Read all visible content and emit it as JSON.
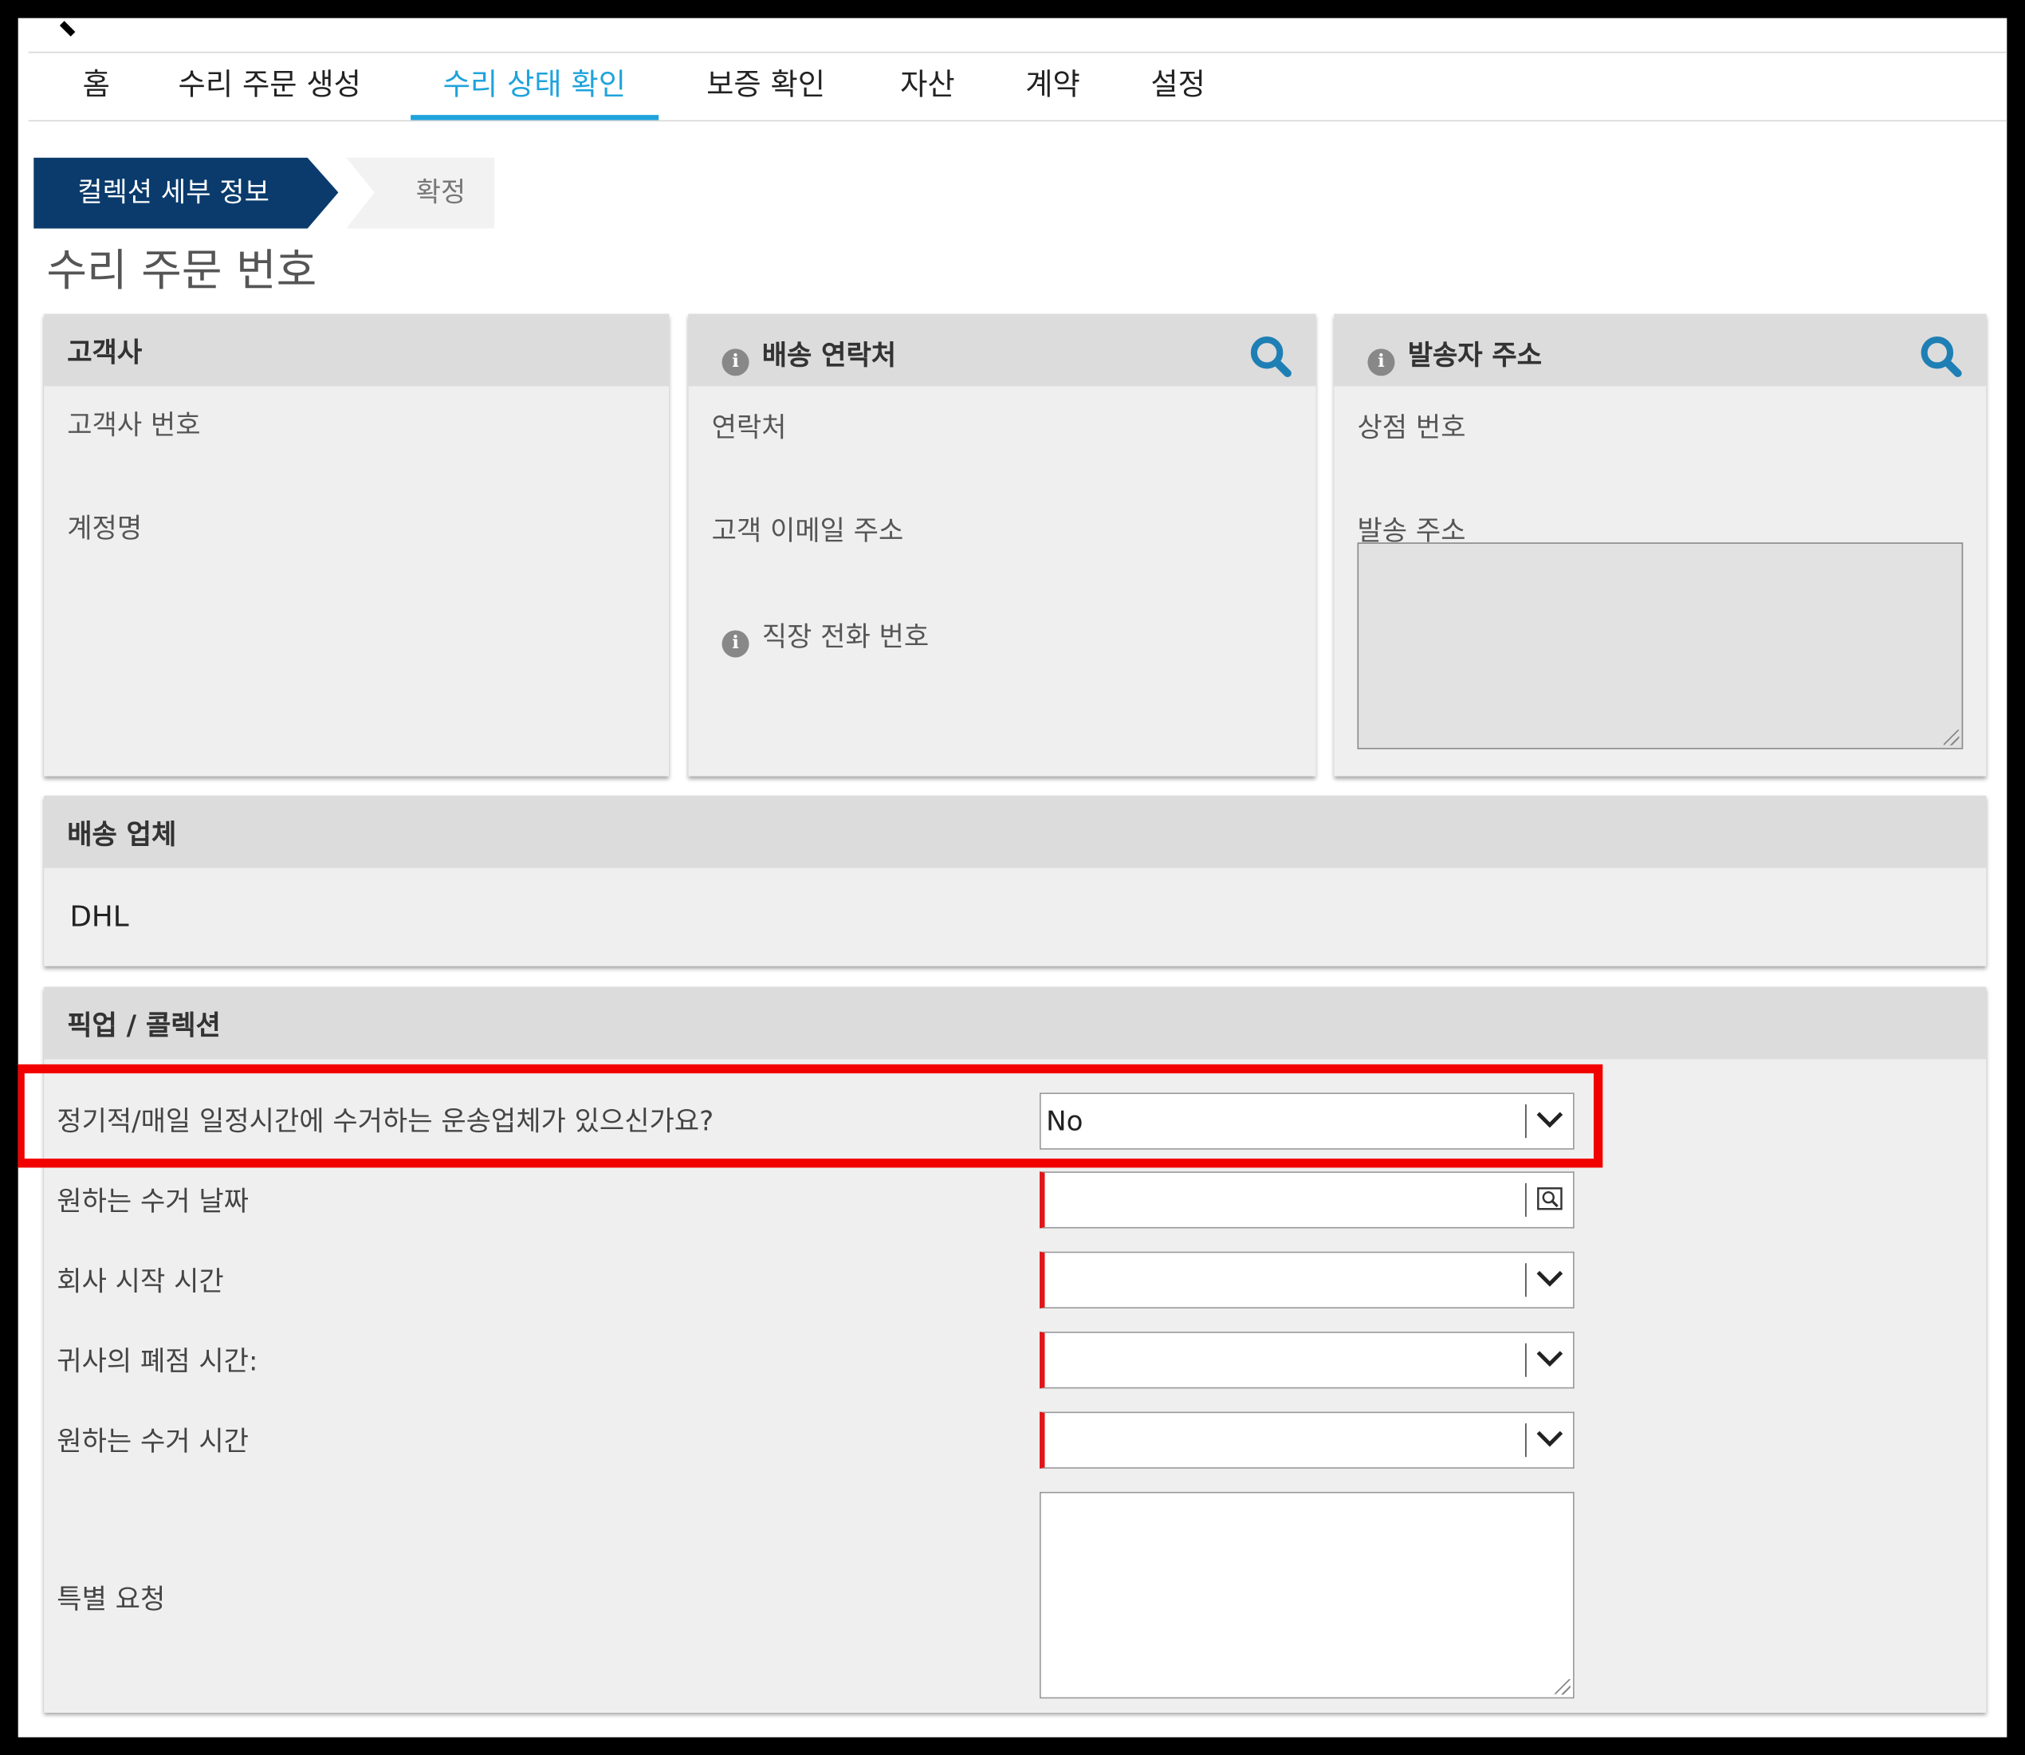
{
  "nav": {
    "items": [
      {
        "label": "홈"
      },
      {
        "label": "수리 주문 생성"
      },
      {
        "label": "수리 상태 확인"
      },
      {
        "label": "보증 확인"
      },
      {
        "label": "자산"
      },
      {
        "label": "계약"
      },
      {
        "label": "설정"
      }
    ],
    "active_index": 2,
    "accent_color": "#1fa3dc"
  },
  "steps": {
    "current": "컬렉션 세부 정보",
    "next": "확정",
    "current_color": "#0a3b6c"
  },
  "page_title": "수리 주문 번호",
  "customer_panel": {
    "title": "고객사",
    "fields": [
      "고객사 번호",
      "계정명"
    ]
  },
  "shipping_contact_panel": {
    "title": "배송 연락처",
    "icon": "info-icon",
    "action_icon": "search-icon",
    "fields": [
      "연락처",
      "고객 이메일 주소",
      "직장 전화 번호"
    ]
  },
  "sender_panel": {
    "title": "발송자 주소",
    "icon": "info-icon",
    "action_icon": "search-icon",
    "fields": [
      "상점 번호",
      "발송 주소"
    ]
  },
  "carrier_panel": {
    "title": "배송 업체",
    "value": "DHL"
  },
  "pickup_panel": {
    "title": "픽업 / 콜렉션",
    "rows": [
      {
        "label": "정기적/매일 일정시간에 수거하는 운송업체가 있으신가요?",
        "value": "No",
        "control": "select",
        "required": false
      },
      {
        "label": "원하는 수거 날짜",
        "value": "",
        "control": "date",
        "required": true
      },
      {
        "label": "회사 시작 시간",
        "value": "",
        "control": "select",
        "required": true
      },
      {
        "label": "귀사의 폐점 시간:",
        "value": "",
        "control": "select",
        "required": true
      },
      {
        "label": "원하는 수거 시간",
        "value": "",
        "control": "select",
        "required": true
      },
      {
        "label": "특별 요청",
        "value": "",
        "control": "textarea",
        "required": false
      }
    ],
    "highlight_color": "#f20000",
    "required_color": "#e0161b"
  }
}
